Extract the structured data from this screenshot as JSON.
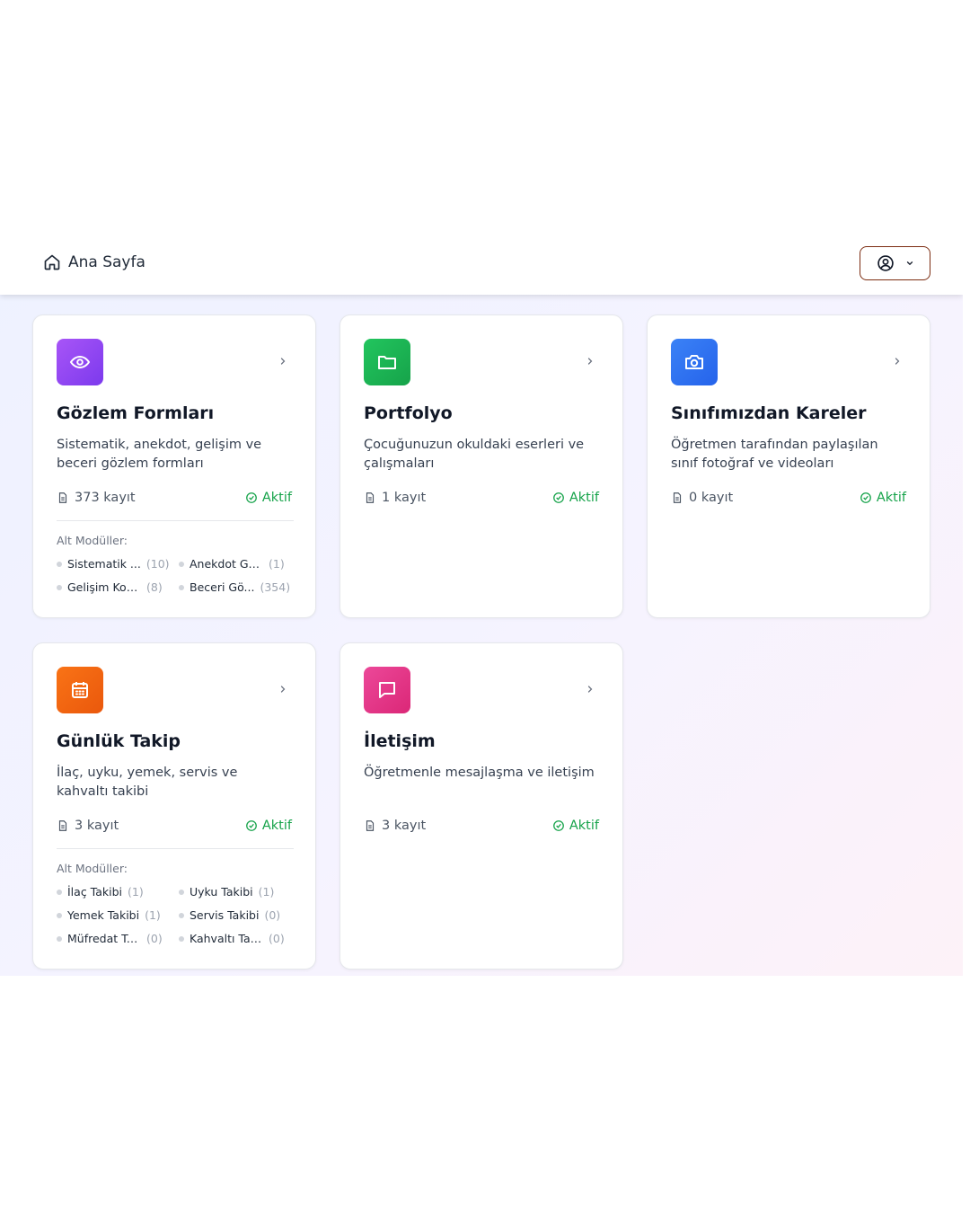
{
  "header": {
    "home_label": "Ana Sayfa"
  },
  "colors": {
    "active": "#16a34a"
  },
  "sub_heading": "Alt Modüller:",
  "cards": [
    {
      "title": "Gözlem Formları",
      "desc": "Sistematik, anekdot, gelişim ve beceri gözlem formları",
      "count": "373 kayıt",
      "status": "Aktif",
      "icon": "eye-icon",
      "subs": [
        {
          "name": "Sistematik ...",
          "count": "(10)"
        },
        {
          "name": "Anekdot Göz...",
          "count": "(1)"
        },
        {
          "name": "Gelişim Kon...",
          "count": "(8)"
        },
        {
          "name": "Beceri Gö...",
          "count": "(354)"
        }
      ]
    },
    {
      "title": "Portfolyo",
      "desc": "Çocuğunuzun okuldaki eserleri ve çalışmaları",
      "count": "1 kayıt",
      "status": "Aktif",
      "icon": "folder-icon"
    },
    {
      "title": "Sınıfımızdan Kareler",
      "desc": "Öğretmen tarafından paylaşılan sınıf fotoğraf ve videoları",
      "count": "0 kayıt",
      "status": "Aktif",
      "icon": "camera-icon"
    },
    {
      "title": "Günlük Takip",
      "desc": "İlaç, uyku, yemek, servis ve kahvaltı takibi",
      "count": "3 kayıt",
      "status": "Aktif",
      "icon": "calendar-icon",
      "subs": [
        {
          "name": "İlaç Takibi",
          "count": "(1)"
        },
        {
          "name": "Uyku Takibi",
          "count": "(1)"
        },
        {
          "name": "Yemek Takibi",
          "count": "(1)"
        },
        {
          "name": "Servis Takibi",
          "count": "(0)"
        },
        {
          "name": "Müfredat Ta...",
          "count": "(0)"
        },
        {
          "name": "Kahvaltı Tak...",
          "count": "(0)"
        }
      ]
    },
    {
      "title": "İletişim",
      "desc": "Öğretmenle mesajlaşma ve iletişim",
      "count": "3 kayıt",
      "status": "Aktif",
      "icon": "message-icon"
    }
  ]
}
